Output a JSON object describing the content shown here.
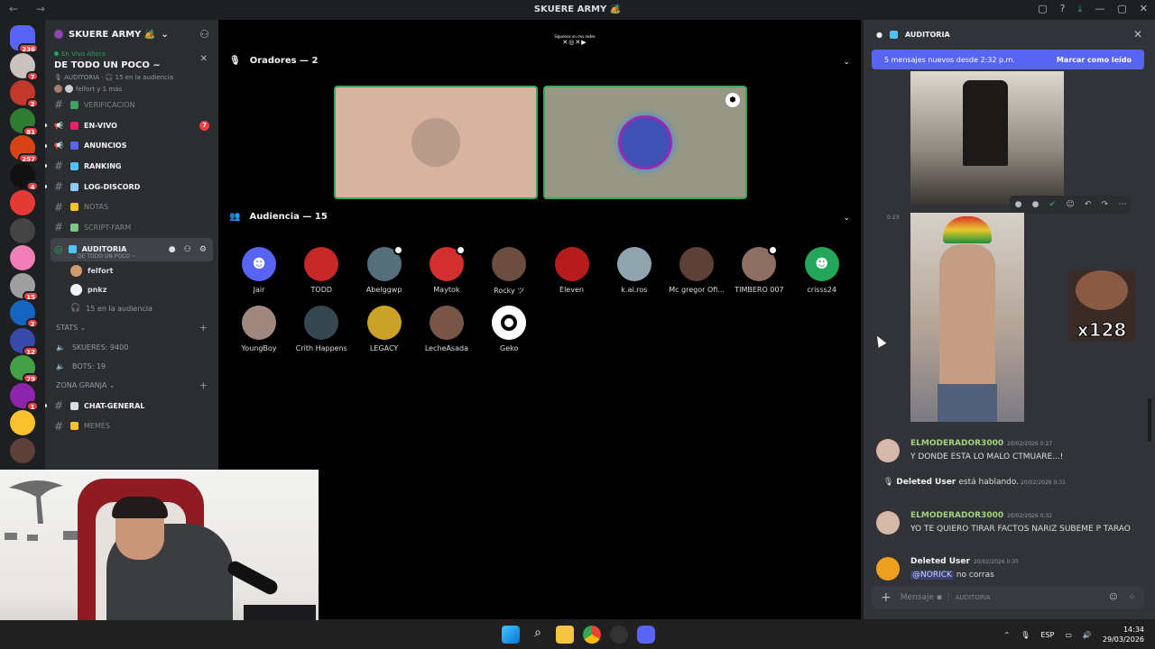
{
  "window": {
    "title": "SKUERE ARMY 🏕️"
  },
  "servers": [
    {
      "color": "#5865f2",
      "badge": "236"
    },
    {
      "color": "#c9c3c0",
      "badge": "7"
    },
    {
      "color": "#c0392b",
      "badge": "2"
    },
    {
      "color": "#2e7d32",
      "badge": "81"
    },
    {
      "color": "#d84315",
      "badge": "257"
    },
    {
      "color": "#111111",
      "badge": "4"
    },
    {
      "color": "#e53935",
      "badge": ""
    },
    {
      "color": "#444444",
      "badge": ""
    },
    {
      "color": "#ef7fb6",
      "badge": ""
    },
    {
      "color": "#9e9e9e",
      "badge": "15"
    },
    {
      "color": "#1565c0",
      "badge": "2"
    },
    {
      "color": "#3949ab",
      "badge": "12"
    },
    {
      "color": "#43a047",
      "badge": "79"
    },
    {
      "color": "#8e24aa",
      "badge": "1"
    },
    {
      "color": "#fbc02d",
      "badge": ""
    },
    {
      "color": "#5d4037",
      "badge": ""
    }
  ],
  "guild": {
    "name": "SKUERE ARMY 🏕️"
  },
  "live": {
    "tag": "En Vivo Ahora",
    "title": "DE TODO UN POCO ~",
    "channel": "AUDITORIA",
    "audience": "15 en la audiencia",
    "users": "felfort y 1 más"
  },
  "channels": [
    {
      "name": "VERIFICACION",
      "icon": "hash",
      "emoji": "#3ba55c",
      "muted": true
    },
    {
      "name": "EN-VIVO",
      "icon": "megaphone",
      "emoji": "#e91e63",
      "ping": "7",
      "bullet": true
    },
    {
      "name": "ANUNCIOS",
      "icon": "megaphone",
      "emoji": "#5865f2",
      "bullet": true
    },
    {
      "name": "RANKING",
      "icon": "hash",
      "emoji": "#4fc3f7",
      "bullet": true
    },
    {
      "name": "LOG-DISCORD",
      "icon": "hash",
      "emoji": "#90caf9",
      "bullet": true
    },
    {
      "name": "NOTAS",
      "icon": "hash",
      "emoji": "#fbc02d",
      "muted": true
    },
    {
      "name": "SCRIPT-FARM",
      "icon": "hash",
      "emoji": "#81c784",
      "muted": true
    }
  ],
  "active_channel": {
    "name": "AUDITORIA",
    "sub": "DE TODO UN POCO ~"
  },
  "voice_users": [
    {
      "name": "felfort",
      "color": "#d29a6f"
    },
    {
      "name": "pnkz",
      "color": "#f2f3f5"
    }
  ],
  "voice_audience": "15 en la audiencia",
  "categories": {
    "stats": "STATS",
    "granja": "ZONA GRANJA"
  },
  "stats": [
    {
      "text": "SKUERES: 9400"
    },
    {
      "text": "BOTS: 19"
    }
  ],
  "granja_channels": [
    {
      "name": "CHAT-GENERAL",
      "emoji": "#dbdee1",
      "bullet": true
    },
    {
      "name": "MEMES",
      "emoji": "#fbc02d",
      "muted": true
    }
  ],
  "stage": {
    "logo_text": "Síguenos en mis redes",
    "speakers_label": "Oradores — 2",
    "audience_label": "Audiencia — 15",
    "speakers": [
      {
        "bg": "#d8b4a0",
        "avatar": "#b89b8a"
      },
      {
        "bg": "#979785",
        "avatar": "#3f51b5",
        "mod": true
      }
    ],
    "audience": [
      {
        "name": "Jair",
        "color": "#5865f2",
        "discord": true
      },
      {
        "name": "TODD",
        "color": "#c62828"
      },
      {
        "name": "Abelggwp",
        "color": "#546e7a",
        "mod": true
      },
      {
        "name": "Maytok",
        "color": "#d32f2f",
        "mod": true
      },
      {
        "name": "Rocky ツ",
        "color": "#6d4c41"
      },
      {
        "name": "Eleven",
        "color": "#b71c1c"
      },
      {
        "name": "k.ai.ros",
        "color": "#90a4ae"
      },
      {
        "name": "Mc gregor Ofi...",
        "color": "#5d4037"
      },
      {
        "name": "TIMBERO 007",
        "color": "#8d6e63",
        "mod": true
      },
      {
        "name": "crisss24",
        "color": "#23a55a",
        "discord": true
      },
      {
        "name": "YoungBoy",
        "color": "#a1887f"
      },
      {
        "name": "Crith Happens",
        "color": "#37474f"
      },
      {
        "name": "LEGACY",
        "color": "#c9a227"
      },
      {
        "name": "LecheAsada",
        "color": "#795548"
      },
      {
        "name": "Geko",
        "color": "#ffffff"
      }
    ]
  },
  "chat": {
    "channel": "AUDITORIA",
    "new_bar": "5 mensajes nuevos desde 2:32 p.m.",
    "mark_read": "Marcar como leído",
    "img_time": "0:23",
    "sticker": "x128",
    "messages": [
      {
        "kind": "msg",
        "user": "ELMODERADOR3000",
        "ts": "20/02/2026 0:27",
        "text": "Y DONDE ESTA LO MALO CTMUARE...!",
        "av": "#d6b8a8",
        "color": "green"
      },
      {
        "kind": "sys",
        "user": "Deleted User",
        "text": "está hablando.",
        "ts": "20/02/2026 0:31"
      },
      {
        "kind": "msg",
        "user": "ELMODERADOR3000",
        "ts": "20/02/2026 0:32",
        "text": "YO TE QUIERO TIRAR FACTOS NARIZ SUBEME P TARAO",
        "av": "#d6b8a8",
        "color": "green"
      },
      {
        "kind": "msg",
        "user": "Deleted User",
        "ts": "20/02/2026 0:35",
        "mention": "@NORICK",
        "text": "no corras",
        "av": "#f0a020",
        "color": "white"
      }
    ],
    "composer_placeholder": "Mensaje",
    "composer_channel": "AUDITORIA"
  },
  "taskbar": {
    "lang": "ESP",
    "time": "14:34",
    "date": "29/03/2026"
  }
}
